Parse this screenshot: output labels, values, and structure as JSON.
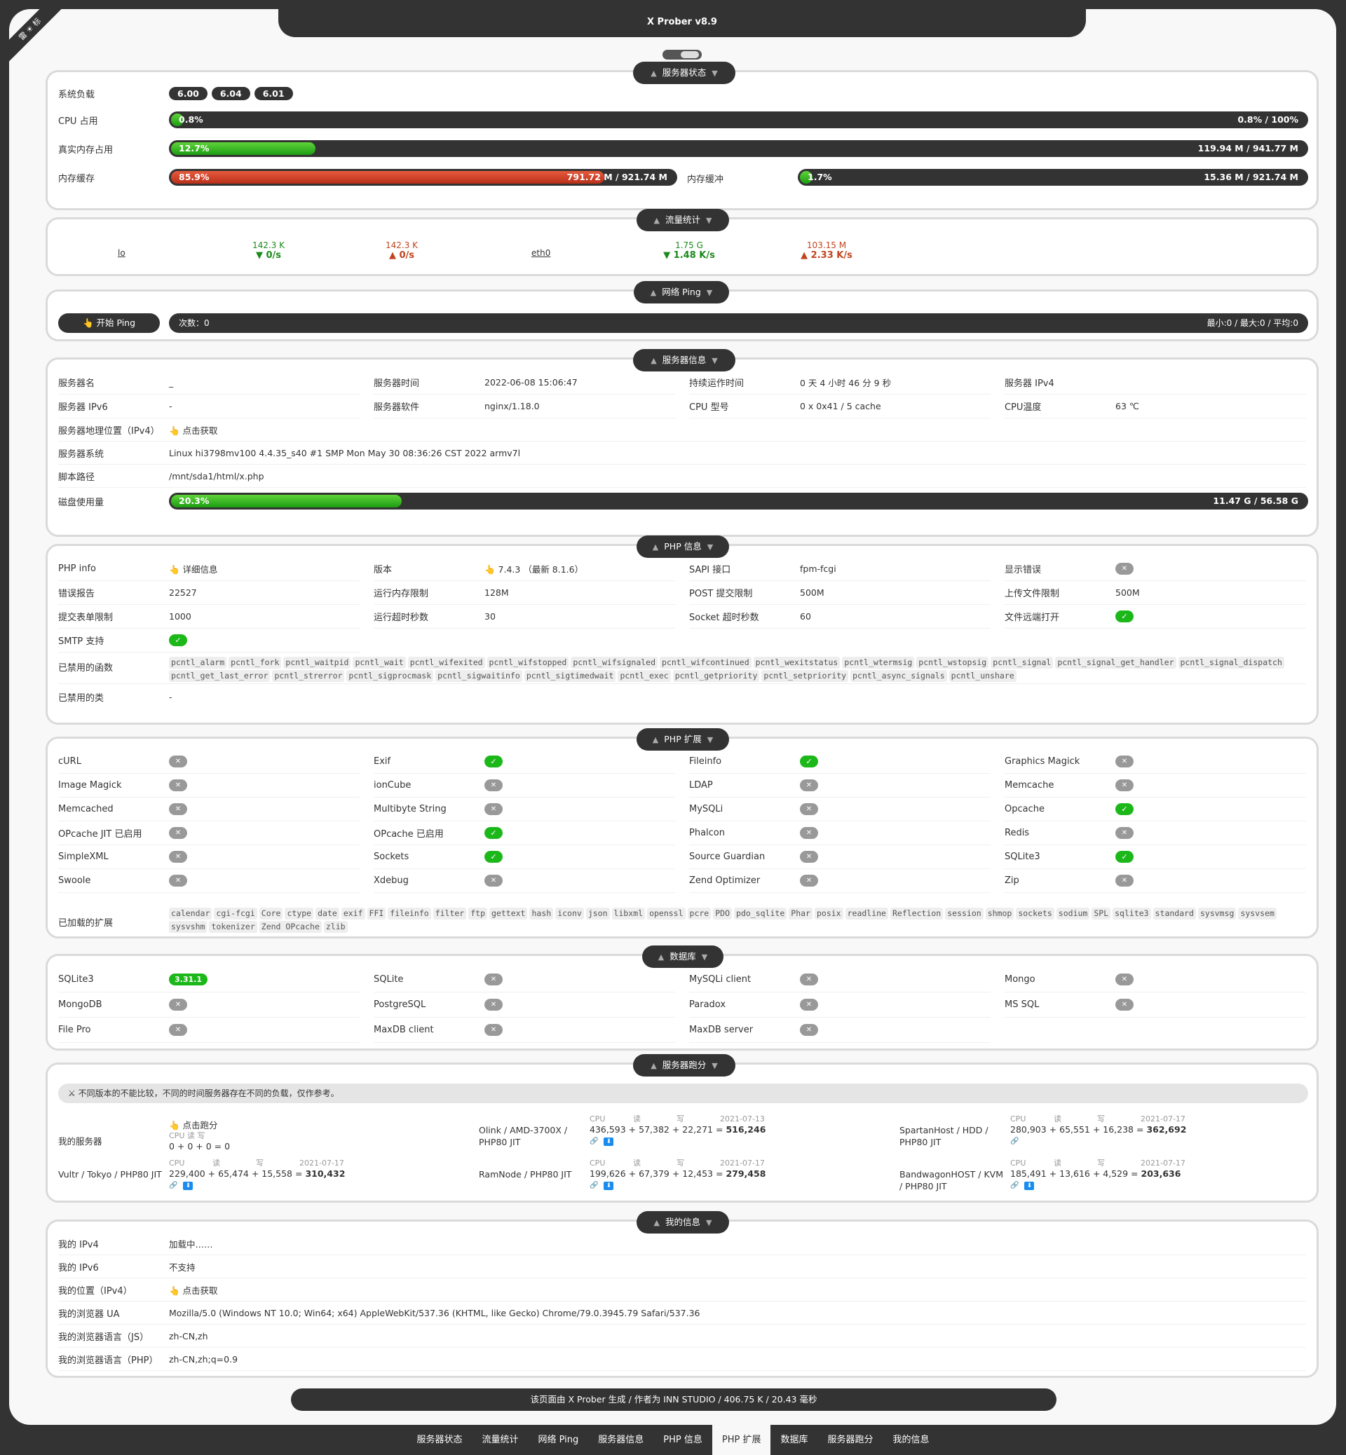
{
  "header": {
    "title": "X Prober v8.9",
    "ribbon": "雷 ☀ 标"
  },
  "status": {
    "legend": "服务器状态",
    "load_label": "系统负载",
    "loads": [
      "6.00",
      "6.04",
      "6.01"
    ],
    "cpu_label": "CPU 占用",
    "cpu_pct": "0.8%",
    "cpu_right": "0.8% / 100%",
    "cpu_fill": 0.008,
    "mem_label": "真实内存占用",
    "mem_pct": "12.7%",
    "mem_right": "119.94 M / 941.77 M",
    "mem_fill": 0.127,
    "cache_label": "内存缓存",
    "cache_pct": "85.9%",
    "cache_right": "791.72 M / 921.74 M",
    "cache_fill": 0.859,
    "buffer_label": "内存缓冲",
    "buffer_pct": "1.7%",
    "buffer_right": "15.36 M / 921.74 M",
    "buffer_fill": 0.017
  },
  "traffic": {
    "legend": "流量统计",
    "ifaces": [
      {
        "name": "lo",
        "tx_total": "142.3 K",
        "tx_rate": "▼ 0/s",
        "rx_total": "142.3 K",
        "rx_rate": "▲ 0/s"
      },
      {
        "name": "eth0",
        "tx_total": "1.75 G",
        "tx_rate": "▼ 1.48 K/s",
        "rx_total": "103.15 M",
        "rx_rate": "▲ 2.33 K/s"
      }
    ]
  },
  "ping": {
    "legend": "网络 Ping",
    "button": "👆 开始 Ping",
    "count": "次数：0",
    "stats": "最小:0 / 最大:0 / 平均:0"
  },
  "info": {
    "legend": "服务器信息",
    "cells": [
      {
        "label": "服务器名",
        "value": "_"
      },
      {
        "label": "服务器时间",
        "value": "2022-06-08 15:06:47"
      },
      {
        "label": "持续运作时间",
        "value": "0 天 4 小时 46 分 9 秒"
      },
      {
        "label": "服务器 IPv4",
        "value": ""
      },
      {
        "label": "服务器 IPv6",
        "value": "-"
      },
      {
        "label": "服务器软件",
        "value": "nginx/1.18.0"
      },
      {
        "label": "CPU 型号",
        "value": "0 x 0x41 / 5 cache"
      },
      {
        "label": "CPU温度",
        "value": "63 ℃"
      }
    ],
    "geo_label": "服务器地理位置（IPv4）",
    "geo_value": "👆 点击获取",
    "os_label": "服务器系统",
    "os_value": "Linux hi3798mv100 4.4.35_s40 #1 SMP Mon May 30 08:36:26 CST 2022 armv7l",
    "path_label": "脚本路径",
    "path_value": "/mnt/sda1/html/x.php",
    "disk_label": "磁盘使用量",
    "disk_pct": "20.3%",
    "disk_right": "11.47 G / 56.58 G",
    "disk_fill": 0.203
  },
  "php": {
    "legend": "PHP 信息",
    "cells": [
      {
        "label": "PHP info",
        "value": "👆 详细信息",
        "kind": "text"
      },
      {
        "label": "版本",
        "value": "👆 7.4.3 （最新 8.1.6）",
        "kind": "text"
      },
      {
        "label": "SAPI 接口",
        "value": "fpm-fcgi",
        "kind": "text"
      },
      {
        "label": "显示错误",
        "value": "✕",
        "kind": "x"
      },
      {
        "label": "错误报告",
        "value": "22527",
        "kind": "text"
      },
      {
        "label": "运行内存限制",
        "value": "128M",
        "kind": "text"
      },
      {
        "label": "POST 提交限制",
        "value": "500M",
        "kind": "text"
      },
      {
        "label": "上传文件限制",
        "value": "500M",
        "kind": "text"
      },
      {
        "label": "提交表单限制",
        "value": "1000",
        "kind": "text"
      },
      {
        "label": "运行超时秒数",
        "value": "30",
        "kind": "text"
      },
      {
        "label": "Socket 超时秒数",
        "value": "60",
        "kind": "text"
      },
      {
        "label": "文件远端打开",
        "value": "✓",
        "kind": "ok"
      },
      {
        "label": "SMTP 支持",
        "value": "✓",
        "kind": "ok"
      }
    ],
    "disabled_funcs_label": "已禁用的函数",
    "disabled_funcs": [
      "pcntl_alarm",
      "pcntl_fork",
      "pcntl_waitpid",
      "pcntl_wait",
      "pcntl_wifexited",
      "pcntl_wifstopped",
      "pcntl_wifsignaled",
      "pcntl_wifcontinued",
      "pcntl_wexitstatus",
      "pcntl_wtermsig",
      "pcntl_wstopsig",
      "pcntl_signal",
      "pcntl_signal_get_handler",
      "pcntl_signal_dispatch",
      "pcntl_get_last_error",
      "pcntl_strerror",
      "pcntl_sigprocmask",
      "pcntl_sigwaitinfo",
      "pcntl_sigtimedwait",
      "pcntl_exec",
      "pcntl_getpriority",
      "pcntl_setpriority",
      "pcntl_async_signals",
      "pcntl_unshare"
    ],
    "disabled_classes_label": "已禁用的类",
    "disabled_classes": "-"
  },
  "ext": {
    "legend": "PHP 扩展",
    "cells": [
      {
        "label": "cURL",
        "value": "✕",
        "kind": "x"
      },
      {
        "label": "Exif",
        "value": "✓",
        "kind": "ok"
      },
      {
        "label": "Fileinfo",
        "value": "✓",
        "kind": "ok"
      },
      {
        "label": "Graphics Magick",
        "value": "✕",
        "kind": "x"
      },
      {
        "label": "Image Magick",
        "value": "✕",
        "kind": "x"
      },
      {
        "label": "ionCube",
        "value": "✕",
        "kind": "x"
      },
      {
        "label": "LDAP",
        "value": "✕",
        "kind": "x"
      },
      {
        "label": "Memcache",
        "value": "✕",
        "kind": "x"
      },
      {
        "label": "Memcached",
        "value": "✕",
        "kind": "x"
      },
      {
        "label": "Multibyte String",
        "value": "✕",
        "kind": "x"
      },
      {
        "label": "MySQLi",
        "value": "✕",
        "kind": "x"
      },
      {
        "label": "Opcache",
        "value": "✓",
        "kind": "ok"
      },
      {
        "label": "OPcache JIT 已启用",
        "value": "✕",
        "kind": "x"
      },
      {
        "label": "OPcache 已启用",
        "value": "✓",
        "kind": "ok"
      },
      {
        "label": "Phalcon",
        "value": "✕",
        "kind": "x"
      },
      {
        "label": "Redis",
        "value": "✕",
        "kind": "x"
      },
      {
        "label": "SimpleXML",
        "value": "✕",
        "kind": "x"
      },
      {
        "label": "Sockets",
        "value": "✓",
        "kind": "ok"
      },
      {
        "label": "Source Guardian",
        "value": "✕",
        "kind": "x"
      },
      {
        "label": "SQLite3",
        "value": "✓",
        "kind": "ok"
      },
      {
        "label": "Swoole",
        "value": "✕",
        "kind": "x"
      },
      {
        "label": "Xdebug",
        "value": "✕",
        "kind": "x"
      },
      {
        "label": "Zend Optimizer",
        "value": "✕",
        "kind": "x"
      },
      {
        "label": "Zip",
        "value": "✕",
        "kind": "x"
      }
    ],
    "loaded_label": "已加载的扩展",
    "loaded": [
      "calendar",
      "cgi-fcgi",
      "Core",
      "ctype",
      "date",
      "exif",
      "FFI",
      "fileinfo",
      "filter",
      "ftp",
      "gettext",
      "hash",
      "iconv",
      "json",
      "libxml",
      "openssl",
      "pcre",
      "PDO",
      "pdo_sqlite",
      "Phar",
      "posix",
      "readline",
      "Reflection",
      "session",
      "shmop",
      "sockets",
      "sodium",
      "SPL",
      "sqlite3",
      "standard",
      "sysvmsg",
      "sysvsem",
      "sysvshm",
      "tokenizer",
      "Zend OPcache",
      "zlib"
    ]
  },
  "db": {
    "legend": "数据库",
    "cells": [
      {
        "label": "SQLite3",
        "value": "3.31.1",
        "kind": "ver"
      },
      {
        "label": "SQLite",
        "value": "✕",
        "kind": "x"
      },
      {
        "label": "MySQLi client",
        "value": "✕",
        "kind": "x"
      },
      {
        "label": "Mongo",
        "value": "✕",
        "kind": "x"
      },
      {
        "label": "MongoDB",
        "value": "✕",
        "kind": "x"
      },
      {
        "label": "PostgreSQL",
        "value": "✕",
        "kind": "x"
      },
      {
        "label": "Paradox",
        "value": "✕",
        "kind": "x"
      },
      {
        "label": "MS SQL",
        "value": "✕",
        "kind": "x"
      },
      {
        "label": "File Pro",
        "value": "✕",
        "kind": "x"
      },
      {
        "label": "MaxDB client",
        "value": "✕",
        "kind": "x"
      },
      {
        "label": "MaxDB server",
        "value": "✕",
        "kind": "x"
      }
    ]
  },
  "bench": {
    "legend": "服务器跑分",
    "notice": "⚔ 不同版本的不能比较，不同的时间服务器存在不同的负载，仅作参考。",
    "my_label": "我的服务器",
    "my_action": "👆 点击跑分",
    "my_head": "CPU 读 写",
    "my_score": "0 + 0 + 0 = 0",
    "head_cpu": "CPU",
    "head_read": "读",
    "head_write": "写",
    "servers": [
      {
        "name": "Olink / AMD-3700X / PHP80 JIT",
        "date": "2021-07-13",
        "formula": "436,593 + 57,382 + 22,271 =",
        "total": "516,246"
      },
      {
        "name": "SpartanHost / HDD / PHP80 JIT",
        "date": "2021-07-17",
        "formula": "280,903 + 65,551 + 16,238 =",
        "total": "362,692"
      },
      {
        "name": "Vultr / Tokyo / PHP80 JIT",
        "date": "2021-07-17",
        "formula": "229,400 + 65,474 + 15,558 =",
        "total": "310,432"
      },
      {
        "name": "RamNode / PHP80 JIT",
        "date": "2021-07-17",
        "formula": "199,626 + 67,379 + 12,453 =",
        "total": "279,458"
      },
      {
        "name": "BandwagonHOST / KVM / PHP80 JIT",
        "date": "2021-07-17",
        "formula": "185,491 + 13,616 + 4,529 =",
        "total": "203,636"
      }
    ]
  },
  "mine": {
    "legend": "我的信息",
    "rows": [
      {
        "label": "我的 IPv4",
        "value": "加载中……"
      },
      {
        "label": "我的 IPv6",
        "value": "不支持"
      },
      {
        "label": "我的位置（IPv4）",
        "value": "👆 点击获取"
      },
      {
        "label": "我的浏览器 UA",
        "value": "Mozilla/5.0 (Windows NT 10.0; Win64; x64) AppleWebKit/537.36 (KHTML, like Gecko) Chrome/79.0.3945.79 Safari/537.36"
      },
      {
        "label": "我的浏览器语言（JS）",
        "value": "zh-CN,zh"
      },
      {
        "label": "我的浏览器语言（PHP）",
        "value": "zh-CN,zh;q=0.9"
      }
    ]
  },
  "footer": "该页面由 X Prober 生成 / 作者为 INN STUDIO / 406.75 K / 20.43 毫秒",
  "nav": [
    "服务器状态",
    "流量统计",
    "网络 Ping",
    "服务器信息",
    "PHP 信息",
    "PHP 扩展",
    "数据库",
    "服务器跑分",
    "我的信息"
  ],
  "nav_active": "PHP 扩展",
  "colors": {
    "accent_green": "#1cb81a",
    "accent_red": "#c0441d",
    "dark": "#333333"
  }
}
